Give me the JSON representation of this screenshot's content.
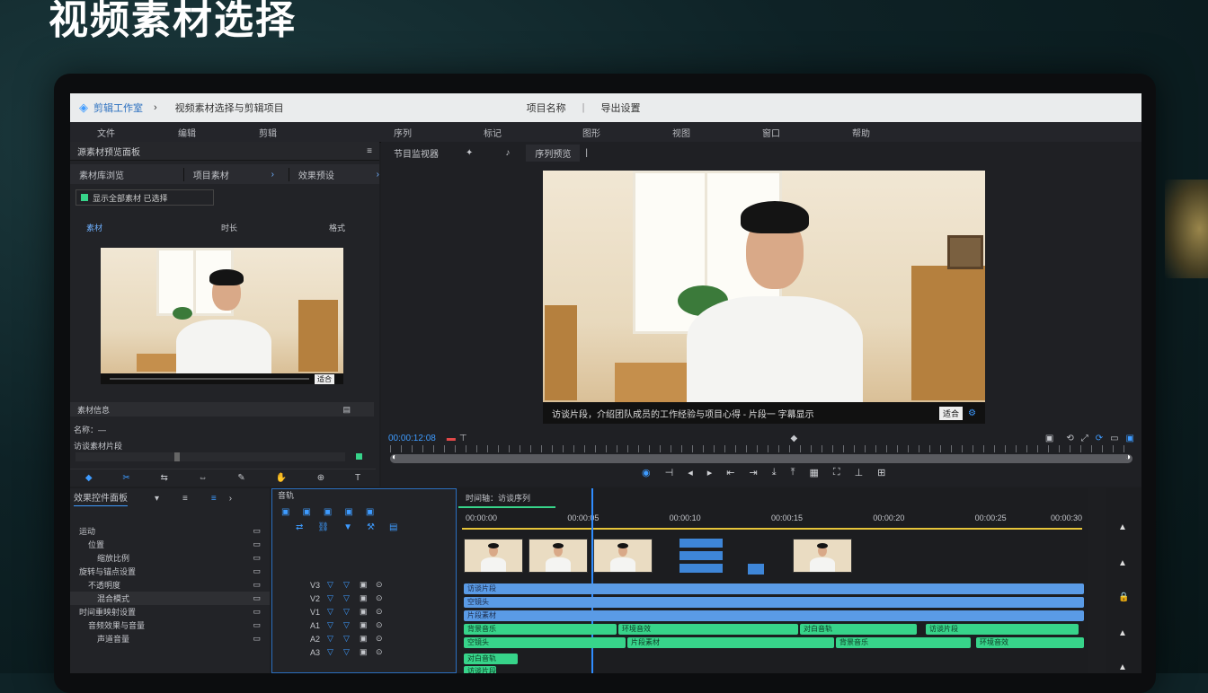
{
  "headline": "视频素材选择",
  "app": {
    "title_left": "剪辑工作室",
    "breadcrumb": "视频素材选择与剪辑项目",
    "center_title": "项目名称",
    "right_title": "导出设置"
  },
  "menu": [
    "文件",
    "编辑",
    "剪辑",
    "序列",
    "标记",
    "图形",
    "视图",
    "窗口",
    "帮助"
  ],
  "source_panel": {
    "title": "源素材预览面板",
    "tabs": [
      "素材库浏览",
      "项目素材",
      "效果预设"
    ],
    "filter": "显示全部素材 已选择",
    "cols": [
      "素材",
      "时长",
      "格式"
    ],
    "footer": "素材信息",
    "info_label": "名称：",
    "info_value": "访谈素材片段",
    "tools": [
      "选择",
      "剪切",
      "波纹",
      "滑动",
      "钢笔",
      "手形",
      "缩放",
      "文字"
    ]
  },
  "program_panel": {
    "tabs": [
      "节目监视器",
      "效果",
      "音频",
      "序列预览"
    ],
    "subtitle": "访谈片段，介绍团队成员的工作经验与项目心得 - 片段一 字幕显示",
    "timecode": "00:00:12:08",
    "zoom": "适合",
    "playback": [
      "标记入点",
      "标记出点",
      "后退一帧",
      "播放",
      "前进一帧",
      "插入",
      "覆盖",
      "导出帧"
    ]
  },
  "effects_panel": {
    "title": "效果控件面板",
    "rows": [
      "运动",
      "位置",
      "缩放比例",
      "旋转与锚点设置",
      "不透明度",
      "混合模式",
      "时间重映射设置",
      "音频效果与音量",
      "声道音量"
    ]
  },
  "track_panel": {
    "title": "音轨",
    "headers": [
      "V3",
      "V2",
      "V1",
      "A1",
      "A2",
      "A3"
    ]
  },
  "timeline": {
    "title": "时间轴：访谈序列",
    "ticks": [
      "00:00:00",
      "00:00:05",
      "00:00:10",
      "00:00:15",
      "00:00:20",
      "00:00:25",
      "00:00:30"
    ],
    "clip_labels": [
      "访谈片段",
      "空镜头",
      "片段素材",
      "背景音乐",
      "环境音效",
      "对白音轨"
    ]
  },
  "colors": {
    "accent": "#3e9bff",
    "clip_blue": "#5a9be6",
    "clip_green": "#37d48a",
    "timeline_marker": "#e6c43a"
  }
}
